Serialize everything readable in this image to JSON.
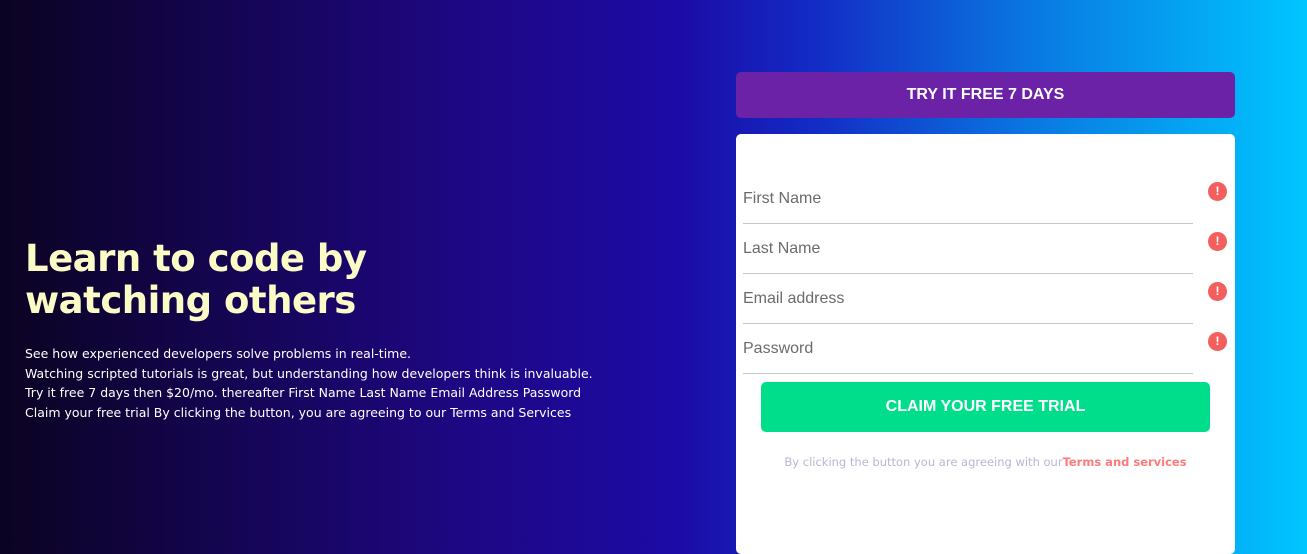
{
  "hero": {
    "title_line1": "Learn to code by",
    "title_line2": "watching others",
    "text_lines": [
      "See how experienced developers solve problems in real-time.",
      "Watching scripted tutorials is great, but understanding how developers think is invaluable.",
      "Try it free 7 days then $20/mo. thereafter First Name Last Name Email Address Password",
      "Claim your free trial By clicking the button, you are agreeing to our Terms and Services"
    ]
  },
  "banner": {
    "label": "TRY IT FREE 7 DAYS"
  },
  "form": {
    "fields": [
      {
        "placeholder": "First Name",
        "value": ""
      },
      {
        "placeholder": "Last Name",
        "value": ""
      },
      {
        "placeholder": "Email address",
        "value": ""
      },
      {
        "placeholder": "Password",
        "value": ""
      }
    ],
    "error_icon_glyph": "!",
    "submit_label": "CLAIM YOUR FREE TRIAL",
    "agree_text": "By clicking the button you are agreeing with our",
    "terms_link": "Terms and services"
  },
  "colors": {
    "banner": "#6c22a6",
    "submit": "#00de8b",
    "error": "#f25f5c",
    "title": "#fbfbc5",
    "link": "#ff7a7a"
  }
}
